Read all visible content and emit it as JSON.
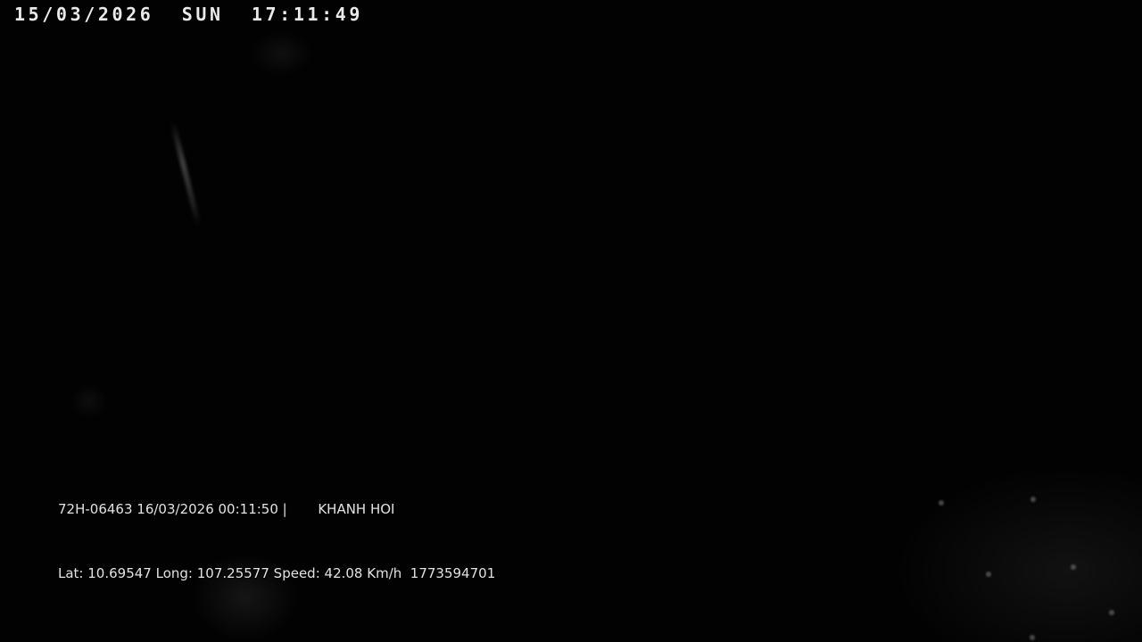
{
  "camera": {
    "timestamp": "15/03/2026  SUN  17:11:49"
  },
  "overlay": {
    "plate": "72H-06463",
    "datetime": "16/03/2026 00:11:50",
    "separator": "|",
    "location": "KHANH HOI",
    "lat_label": "Lat:",
    "lat_value": "10.69547",
    "long_label": "Long:",
    "long_value": "107.25577",
    "speed_label": "Speed:",
    "speed_value": "42.08 Km/h",
    "id": "1773594701"
  },
  "colors": {
    "background": "#020202",
    "text": "#e2e2e2"
  }
}
